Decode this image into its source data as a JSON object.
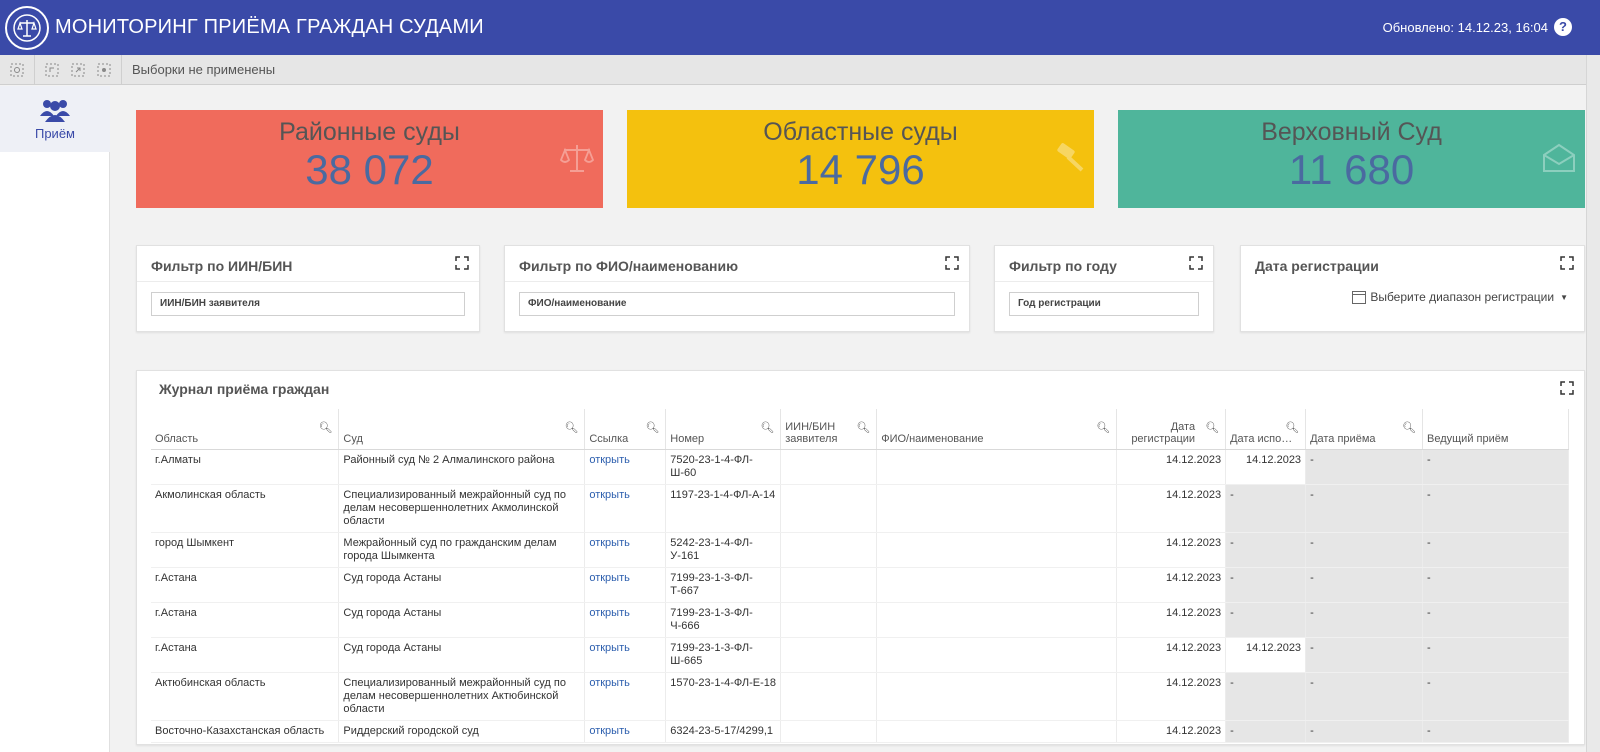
{
  "header": {
    "title": "МОНИТОРИНГ ПРИЁМА ГРАЖДАН СУДАМИ",
    "updated": "Обновлено: 14.12.23, 16:04",
    "help": "?"
  },
  "toolbar": {
    "selections_label": "Выборки не применены"
  },
  "sidebar": {
    "items": [
      {
        "label": "Приём",
        "icon": "users-icon"
      }
    ]
  },
  "kpis": [
    {
      "title": "Районные суды",
      "value": "38 072",
      "color": "#f06b5c",
      "icon": "scales-icon"
    },
    {
      "title": "Областные суды",
      "value": "14 796",
      "color": "#f4c10e",
      "icon": "gavel-icon"
    },
    {
      "title": "Верховный Суд",
      "value": "11 680",
      "color": "#4fb59b",
      "icon": "envelope-icon"
    }
  ],
  "filters": {
    "iin": {
      "title": "Фильтр по ИИН/БИН",
      "field": "ИИН/БИН заявителя"
    },
    "fio": {
      "title": "Фильтр по ФИО/наименованию",
      "field": "ФИО/наименование"
    },
    "year": {
      "title": "Фильтр по году",
      "field": "Год регистрации"
    },
    "date": {
      "title": "Дата регистрации",
      "picker": "Выберите диапазон регистрации"
    }
  },
  "journal": {
    "title": "Журнал приёма граждан",
    "columns": [
      "Область",
      "Суд",
      "Ссылка",
      "Номер",
      "ИИН/БИН заявителя",
      "ФИО/наименование",
      "Дата регистрации",
      "Дата испо…",
      "Дата приёма",
      "Ведущий приём"
    ],
    "rows": [
      {
        "region": "г.Алматы",
        "court": "Районный суд № 2 Алмалинского района",
        "link": "открыть",
        "number": "7520-23-1-4-ФЛ-Ш-60",
        "iin": "",
        "fio": "",
        "reg_date": "14.12.2023",
        "exec_date": "14.12.2023",
        "recv_date": "-",
        "lead": "-"
      },
      {
        "region": "Акмолинская область",
        "court": "Специализированный межрайонный суд по делам несовершеннолетних Акмолинской области",
        "link": "открыть",
        "number": "1197-23-1-4-ФЛ-А-14",
        "iin": "",
        "fio": "",
        "reg_date": "14.12.2023",
        "exec_date": "-",
        "recv_date": "-",
        "lead": "-"
      },
      {
        "region": "город Шымкент",
        "court": "Межрайонный суд по гражданским делам города Шымкента",
        "link": "открыть",
        "number": "5242-23-1-4-ФЛ-У-161",
        "iin": "",
        "fio": "",
        "reg_date": "14.12.2023",
        "exec_date": "-",
        "recv_date": "-",
        "lead": "-"
      },
      {
        "region": "г.Астана",
        "court": "Суд города Астаны",
        "link": "открыть",
        "number": "7199-23-1-3-ФЛ-Т-667",
        "iin": "",
        "fio": "",
        "reg_date": "14.12.2023",
        "exec_date": "-",
        "recv_date": "-",
        "lead": "-"
      },
      {
        "region": "г.Астана",
        "court": "Суд города Астаны",
        "link": "открыть",
        "number": "7199-23-1-3-ФЛ-Ч-666",
        "iin": "",
        "fio": "",
        "reg_date": "14.12.2023",
        "exec_date": "-",
        "recv_date": "-",
        "lead": "-"
      },
      {
        "region": "г.Астана",
        "court": "Суд города Астаны",
        "link": "открыть",
        "number": "7199-23-1-3-ФЛ-Ш-665",
        "iin": "",
        "fio": "",
        "reg_date": "14.12.2023",
        "exec_date": "14.12.2023",
        "recv_date": "-",
        "lead": "-"
      },
      {
        "region": "Актюбинская область",
        "court": "Специализированный межрайонный суд по делам несовершеннолетних Актюбинской области",
        "link": "открыть",
        "number": "1570-23-1-4-ФЛ-Е-18",
        "iin": "",
        "fio": "",
        "reg_date": "14.12.2023",
        "exec_date": "-",
        "recv_date": "-",
        "lead": "-"
      },
      {
        "region": "Восточно-Казахстанская область",
        "court": "Риддерский городской суд",
        "link": "открыть",
        "number": "6324-23-5-17/4299,1",
        "iin": "",
        "fio": "",
        "reg_date": "14.12.2023",
        "exec_date": "-",
        "recv_date": "-",
        "lead": "-"
      }
    ]
  }
}
